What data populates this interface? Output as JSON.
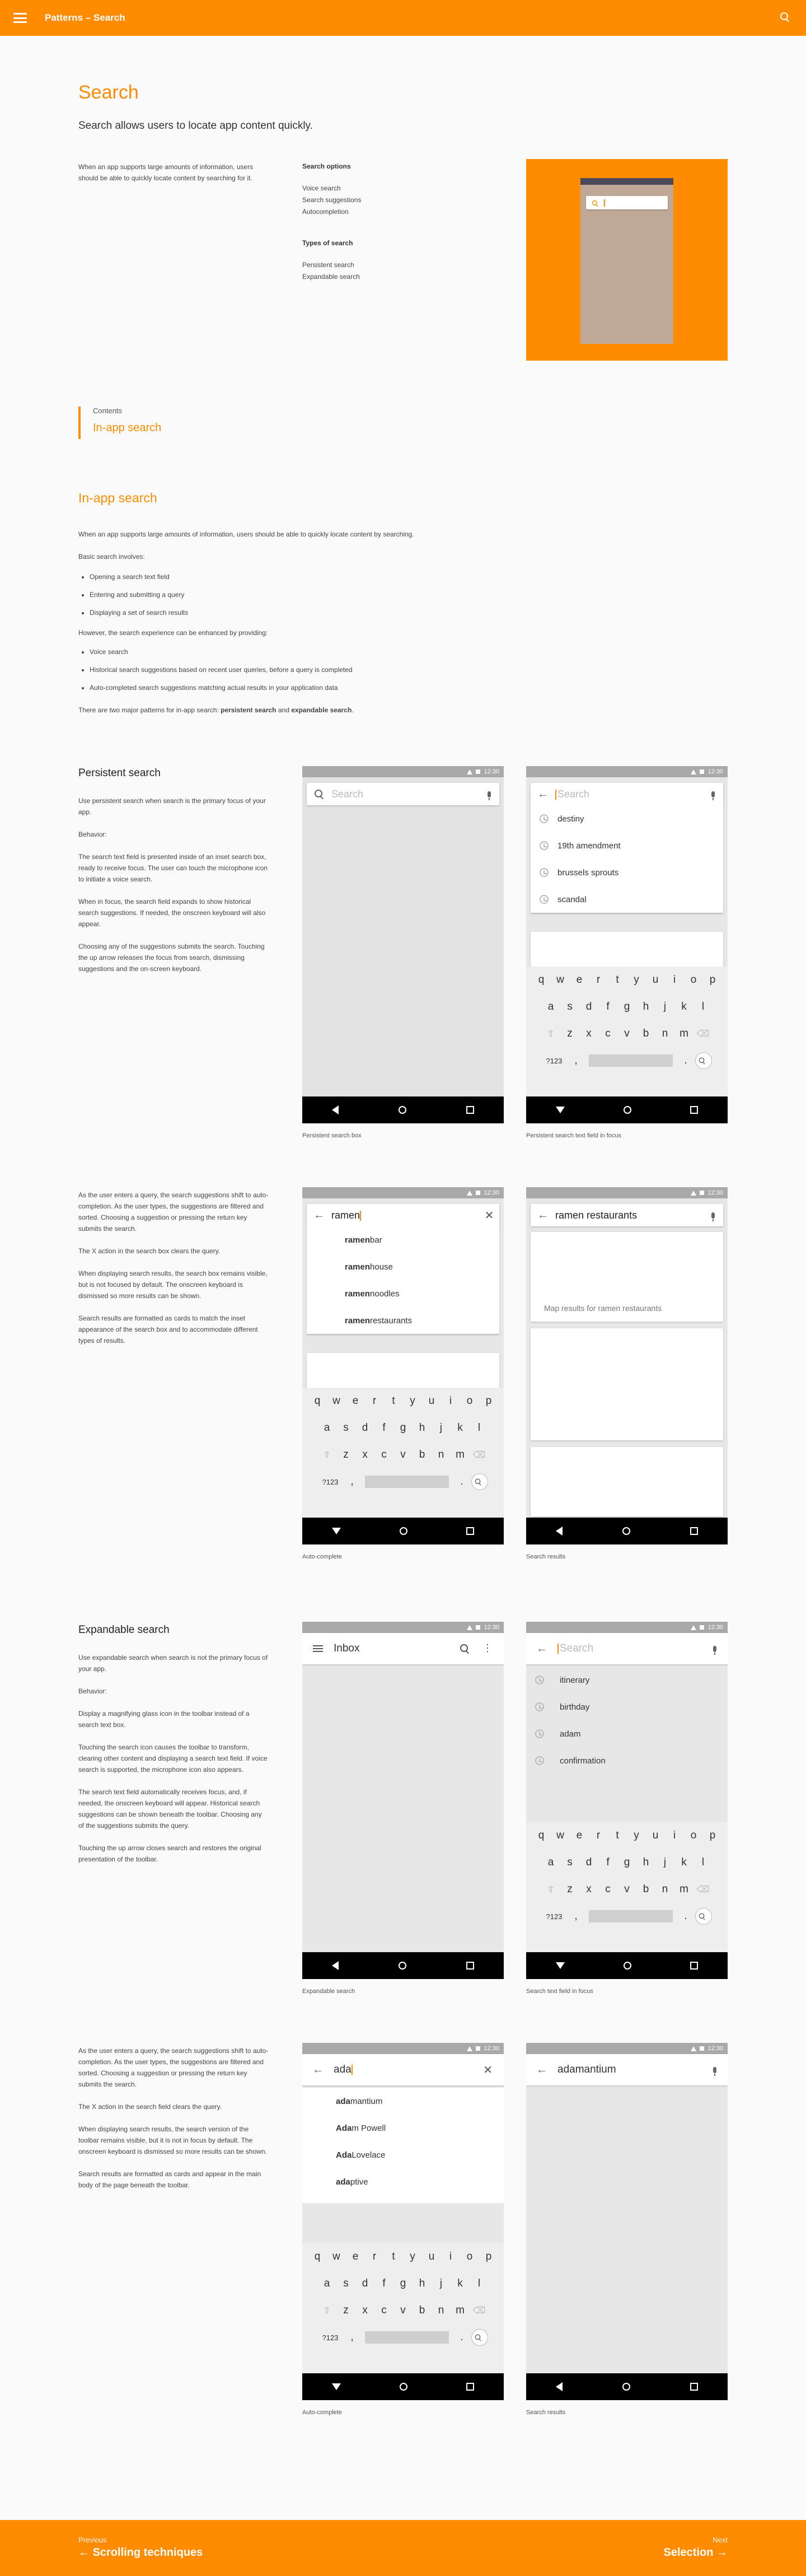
{
  "topbar": {
    "breadcrumb": "Patterns – Search"
  },
  "page": {
    "title": "Search",
    "lead": "Search allows users to locate app content quickly.",
    "intro": "When an app supports large amounts of information, users should be able to quickly locate content by searching for it."
  },
  "search_options": {
    "title": "Search options",
    "items": [
      "Voice search",
      "Search suggestions",
      "Autocompletion"
    ]
  },
  "types_of_search": {
    "title": "Types of search",
    "items": [
      "Persistent search",
      "Expandable search"
    ]
  },
  "contents": {
    "label": "Contents",
    "item": "In-app search"
  },
  "in_app": {
    "title": "In-app search",
    "p1": "When an app supports large amounts of information, users should be able to quickly locate content by searching.",
    "p2": "Basic search involves:",
    "basic": [
      "Opening a search text field",
      "Entering and submitting a query",
      "Displaying a set of search results"
    ],
    "p3": "However, the search experience can be enhanced by providing:",
    "enhanced": [
      "Voice search",
      "Historical search suggestions based on recent user queries, before a query is completed",
      "Auto-completed search suggestions matching actual results in your application data"
    ],
    "p4_pre": "There are two major patterns for in-app search: ",
    "p4_b1": "persistent search",
    "p4_and": " and ",
    "p4_b2": "expandable search",
    "p4_end": "."
  },
  "persistent": {
    "title": "Persistent search",
    "paras": [
      "Use persistent search when search is the primary focus of your app.",
      "Behavior:",
      "The search text field is presented inside of an inset search box, ready to receive focus. The user can touch the microphone icon to initiate a voice search.",
      "When in focus, the search field expands to show historical search suggestions. If needed, the onscreen keyboard will also appear.",
      "Choosing any of the suggestions submits the search. Touching the up arrow releases the focus from search, dismissing suggestions and the on-screen keyboard."
    ],
    "paras2": [
      "As the user enters a query, the search suggestions shift to auto-completion. As the user types, the suggestions are filtered and sorted. Choosing a suggestion or pressing the return key submits the search.",
      "The X action in the search box clears the query.",
      "When displaying search results, the search box remains visible, but is not focused by default. The onscreen keyboard is dismissed so more results can be shown.",
      "Search results are formatted as cards to match the inset appearance of the search box and to accommodate different types of results."
    ],
    "phone1": {
      "placeholder": "Search",
      "caption": "Persistent search box"
    },
    "phone2": {
      "placeholder": "Search",
      "suggestions": [
        "destiny",
        "19th amendment",
        "brussels sprouts",
        "scandal"
      ],
      "caption": "Persistent search text field in focus"
    },
    "phone3": {
      "query": "ramen",
      "suggestions": [
        [
          "ramen",
          " bar"
        ],
        [
          "ramen",
          " house"
        ],
        [
          "ramen",
          " noodles"
        ],
        [
          "ramen",
          " restaurants"
        ]
      ],
      "caption": "Auto-complete"
    },
    "phone4": {
      "query": "ramen restaurants",
      "map_text": "Map results for ramen restaurants",
      "caption": "Search results"
    }
  },
  "expandable": {
    "title": "Expandable search",
    "paras": [
      "Use expandable search when search is not the primary focus of your app.",
      "Behavior:",
      "Display a magnifying glass icon in the toolbar instead of a search text box.",
      "Touching the search icon causes the toolbar to transform, clearing other content and displaying a search text field. If voice search is supported, the microphone icon also appears.",
      "The search text field automatically receives focus, and, if needed, the onscreen keyboard will appear. Historical search suggestions can be shown beneath the toolbar. Choosing any of the suggestions submits the query.",
      "Touching the up arrow closes search and restores the original presentation of the toolbar."
    ],
    "paras2": [
      "As the user enters a query, the search suggestions shift to auto-completion. As the user types, the suggestions are filtered and sorted. Choosing a suggestion or pressing the return key submits the search.",
      "The X action in the search field clears the query.",
      "When displaying search results, the search version of the toolbar remains visible, but it is not in focus by default. The onscreen keyboard is dismissed so more results can be shown.",
      "Search results are formatted as cards and appear in the main body of the page beneath the toolbar."
    ],
    "phone5": {
      "title": "Inbox",
      "caption": "Expandable search"
    },
    "phone6": {
      "placeholder": "Search",
      "suggestions": [
        "itinerary",
        "birthday",
        "adam",
        "confirmation"
      ],
      "caption": "Search text field in focus"
    },
    "phone7": {
      "query": "ada",
      "suggestions": [
        [
          "ada",
          "mantium"
        ],
        [
          "Ada",
          "m Powell"
        ],
        [
          "Ada",
          " Lovelace"
        ],
        [
          "ada",
          "ptive"
        ]
      ],
      "caption": "Auto-complete"
    },
    "phone8": {
      "query": "adamantium",
      "caption": "Search results"
    }
  },
  "status_time": "12:30",
  "keyboard": {
    "row1": [
      "q",
      "w",
      "e",
      "r",
      "t",
      "y",
      "u",
      "i",
      "o",
      "p"
    ],
    "row2": [
      "a",
      "s",
      "d",
      "f",
      "g",
      "h",
      "j",
      "k",
      "l"
    ],
    "row3": [
      "z",
      "x",
      "c",
      "v",
      "b",
      "n",
      "m"
    ],
    "sym": "?123",
    "comma": ",",
    "period": "."
  },
  "footer": {
    "prev_kicker": "Previous",
    "prev_link": "Scrolling techniques",
    "next_kicker": "Next",
    "next_link": "Selection"
  },
  "colors": {
    "accent": "#ff8c00",
    "background": "#fafafa"
  }
}
